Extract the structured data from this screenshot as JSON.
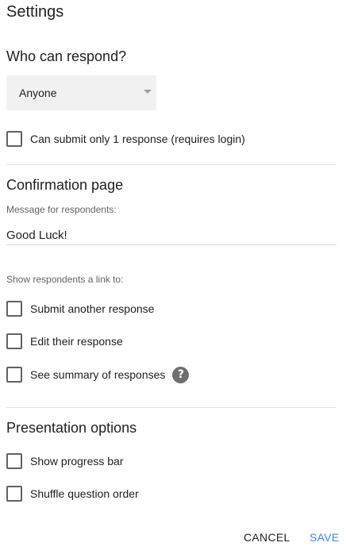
{
  "dialog": {
    "title": "Settings"
  },
  "respond": {
    "heading": "Who can respond?",
    "dropdown_value": "Anyone",
    "limit_label": "Can submit only 1 response (requires login)"
  },
  "confirmation": {
    "heading": "Confirmation page",
    "message_label": "Message for respondents:",
    "message_value": "Good Luck!",
    "link_label": "Show respondents a link to:",
    "options": [
      {
        "label": "Submit another response",
        "checked": false
      },
      {
        "label": "Edit their response",
        "checked": false
      },
      {
        "label": "See summary of responses",
        "checked": false
      }
    ],
    "help_icon": "help-circle-icon"
  },
  "presentation": {
    "heading": "Presentation options",
    "options": [
      {
        "label": "Show progress bar",
        "checked": false
      },
      {
        "label": "Shuffle question order",
        "checked": false
      }
    ]
  },
  "actions": {
    "cancel_label": "CANCEL",
    "save_label": "SAVE"
  },
  "colors": {
    "accent": "#4285f4",
    "checkbox_border": "#5f6368",
    "dropdown_bg": "#f1f1f1",
    "help_icon_bg": "#6f6f6f"
  }
}
